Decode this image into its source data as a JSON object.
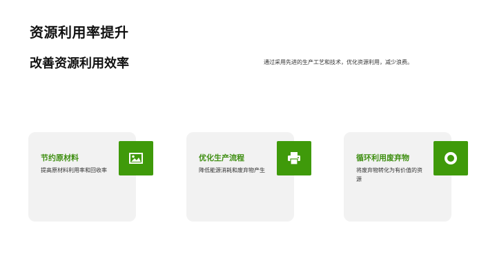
{
  "slide": {
    "title": "资源利用率提升",
    "heading": "改善资源利用效率",
    "description": "通过采用先进的生产工艺和技术，优化资源利用，减少浪费。"
  },
  "cards": [
    {
      "title": "节约原材料",
      "text": "提高原材料利用率和回收率",
      "icon": "image-icon"
    },
    {
      "title": "优化生产流程",
      "text": "降低能源消耗和废弃物产生",
      "icon": "printer-icon"
    },
    {
      "title": "循环利用废弃物",
      "text": "将废弃物转化为有价值的资源",
      "icon": "recycle-ring-icon"
    }
  ],
  "colors": {
    "accent": "#3f9a0a",
    "card_title": "#3f8f12",
    "card_bg": "#f2f2f2"
  }
}
